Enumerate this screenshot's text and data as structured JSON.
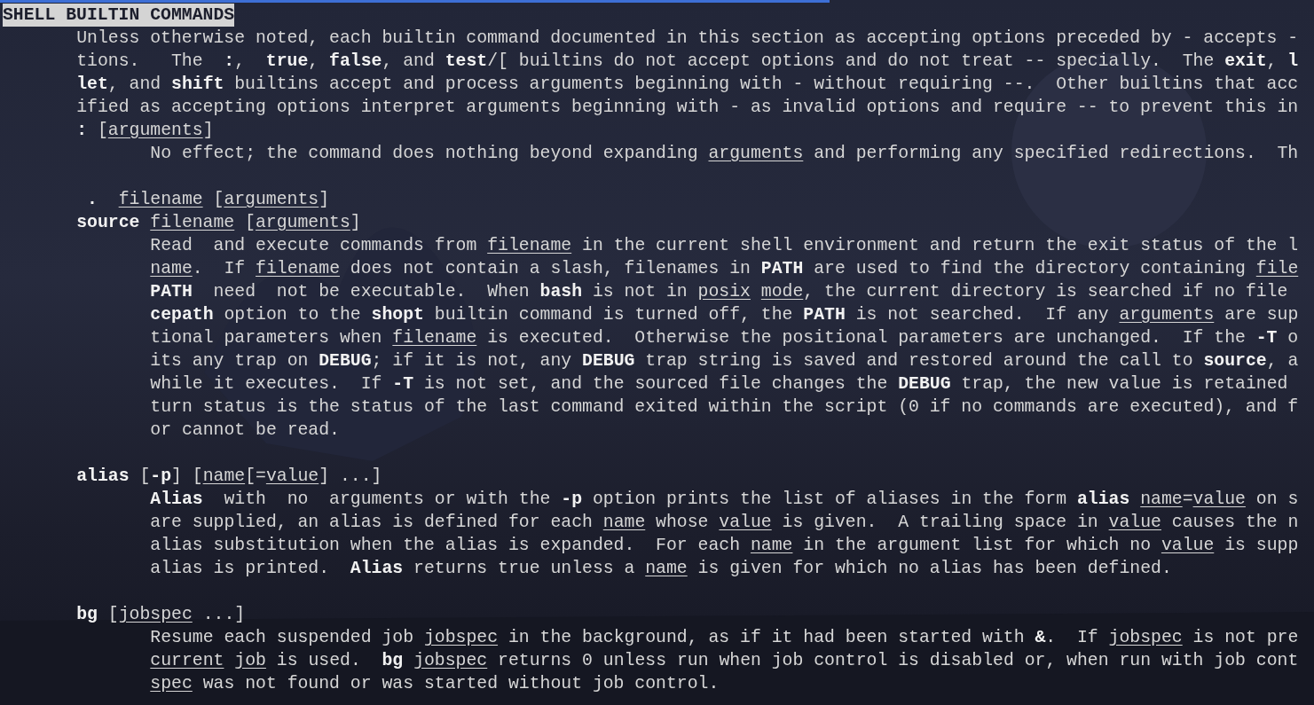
{
  "heading": "SHELL BUILTIN COMMANDS",
  "sections": [
    {
      "kind": "intro",
      "lines": [
        "Unless otherwise noted, each builtin command documented in this section as accepting options preceded by - accepts -",
        "tions.   The  **:**,  **true**, **false**, and **test**/[ builtins do not accept options and do not treat -- specially.  The **exit**, **l**",
        "**let**, and **shift** builtins accept and process arguments beginning with - without requiring --.  Other builtins that acc",
        "ified as accepting options interpret arguments beginning with - as invalid options and require -- to prevent this in"
      ]
    },
    {
      "kind": "entry",
      "terms": [
        "**:** [*arguments*]"
      ],
      "lines": [
        "No effect; the command does nothing beyond expanding *arguments* and performing any specified redirections.  Th"
      ]
    },
    {
      "kind": "entry",
      "terms": [
        " **.**  *filename* [*arguments*]",
        "**source** *filename* [*arguments*]"
      ],
      "lines": [
        "Read  and execute commands from *filename* in the current shell environment and return the exit status of the l",
        "*name*.  If *filename* does not contain a slash, filenames in **PATH** are used to find the directory containing *file*",
        "**PATH**  need  not be executable.  When **bash** is not in *posix* *mode*, the current directory is searched if no file",
        "**cepath** option to the **shopt** builtin command is turned off, the **PATH** is not searched.  If any *arguments* are sup",
        "tional parameters when *filename* is executed.  Otherwise the positional parameters are unchanged.  If the **-T** o",
        "its any trap on **DEBUG**; if it is not, any **DEBUG** trap string is saved and restored around the call to **source**, a",
        "while it executes.  If **-T** is not set, and the sourced file changes the **DEBUG** trap, the new value is retained",
        "turn status is the status of the last command exited within the script (0 if no commands are executed), and f",
        "or cannot be read."
      ]
    },
    {
      "kind": "entry",
      "terms": [
        "**alias** [**-p**] [*name*[=*value*] ...]"
      ],
      "lines": [
        "**Alias**  with  no  arguments or with the **-p** option prints the list of aliases in the form **alias** *name*=*value* on s",
        "are supplied, an alias is defined for each *name* whose *value* is given.  A trailing space in *value* causes the n",
        "alias substitution when the alias is expanded.  For each *name* in the argument list for which no *value* is supp",
        "alias is printed.  **Alias** returns true unless a *name* is given for which no alias has been defined."
      ]
    },
    {
      "kind": "entry",
      "terms": [
        "**bg** [*jobspec* ...]"
      ],
      "lines": [
        "Resume each suspended job *jobspec* in the background, as if it had been started with **&**.  If *jobspec* is not pre",
        "*current* *job* is used.  **bg** *jobspec* returns 0 unless run when job control is disabled or, when run with job cont",
        "*spec* was not found or was started without job control."
      ]
    }
  ]
}
